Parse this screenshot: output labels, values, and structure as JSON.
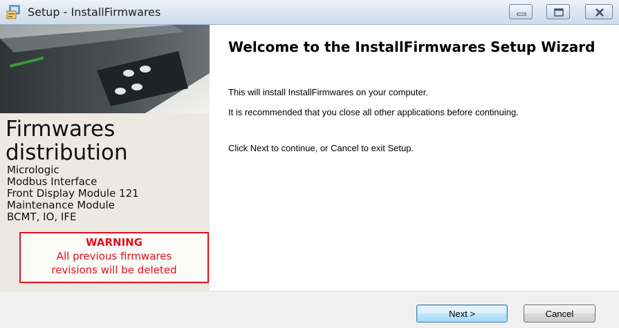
{
  "window": {
    "title": "Setup - InstallFirmwares",
    "icon": "setup-installer-icon",
    "controls": [
      "minimize-icon",
      "maximize-icon",
      "close-icon"
    ]
  },
  "banner": {
    "title_line1": "Firmwares",
    "title_line2": "distribution",
    "items": [
      "Micrologic",
      "Modbus Interface",
      "Front Display Module 121",
      "Maintenance Module",
      "BCMT, IO, IFE"
    ],
    "warning": {
      "title": "WARNING",
      "line1": "All previous firmwares",
      "line2": "revisions will be deleted"
    }
  },
  "wizard": {
    "heading": "Welcome to the InstallFirmwares Setup Wizard",
    "paragraphs": [
      "This will install InstallFirmwares on your computer.",
      "It is recommended that you close all other applications before continuing.",
      "Click Next to continue, or Cancel to exit Setup."
    ]
  },
  "buttons": {
    "next": "Next >",
    "cancel": "Cancel"
  },
  "colors": {
    "warning": "#e3101e",
    "banner_bg": "#ebe9e1",
    "footer_bg": "#f0f0f0",
    "default_button_border": "#3c7fb1"
  }
}
